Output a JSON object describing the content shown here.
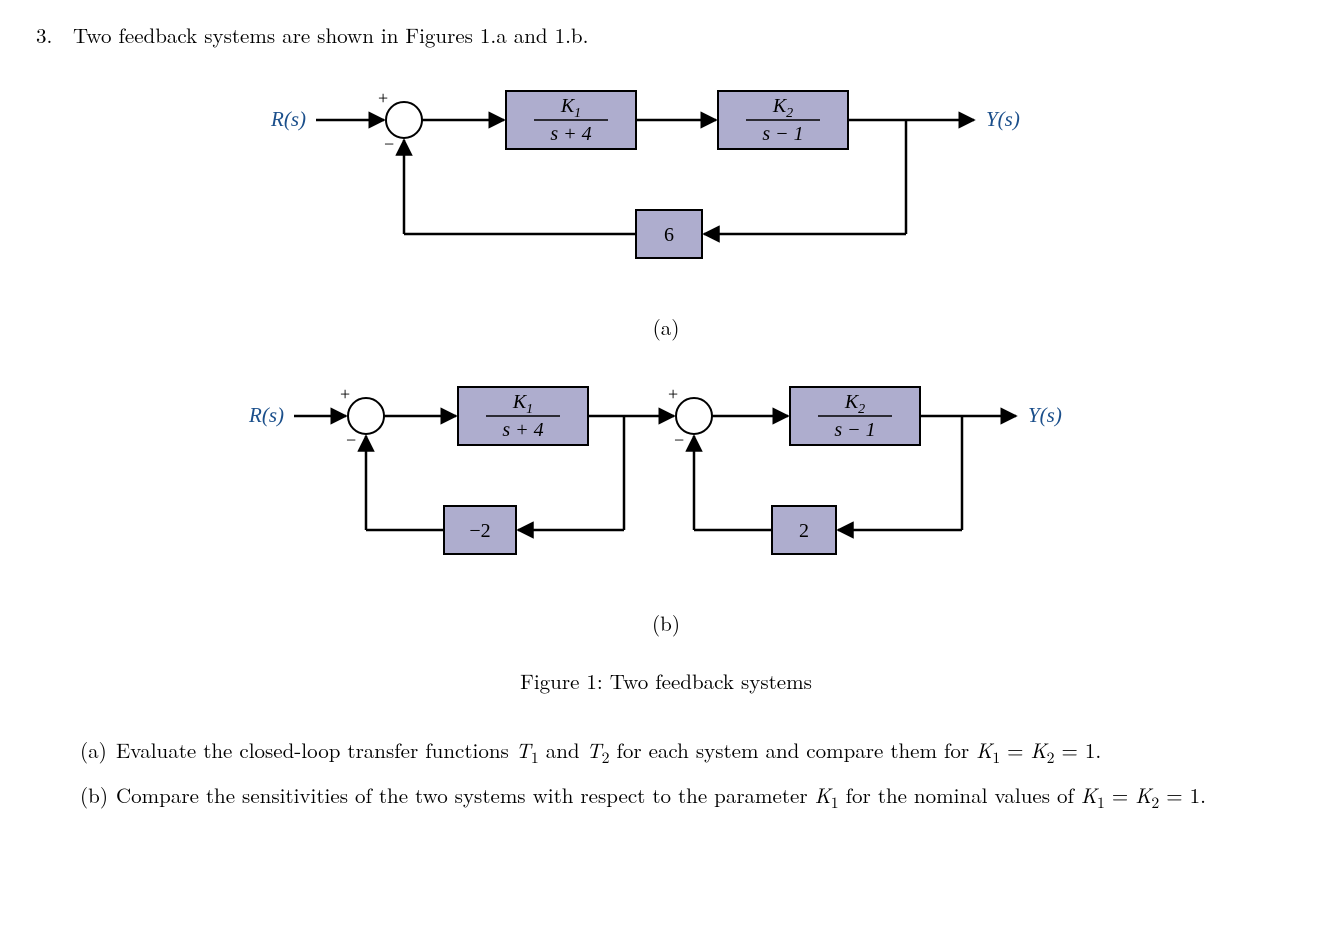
{
  "problem": {
    "number": "3.",
    "text": "Two feedback systems are shown in Figures 1.a and 1.b."
  },
  "figA": {
    "input": "R(s)",
    "output": "Y(s)",
    "b1_num": "K",
    "b1_numsub": "1",
    "b1_den": "s + 4",
    "b2_num": "K",
    "b2_numsub": "2",
    "b2_den": "s − 1",
    "fb": "6",
    "plus": "+",
    "minus": "−",
    "label": "(a)"
  },
  "figB": {
    "input": "R(s)",
    "output": "Y(s)",
    "b1_num": "K",
    "b1_numsub": "1",
    "b1_den": "s + 4",
    "b2_num": "K",
    "b2_numsub": "2",
    "b2_den": "s − 1",
    "fb1": "−2",
    "fb2": "2",
    "plus": "+",
    "minus": "−",
    "label": "(b)"
  },
  "caption": "Figure 1: Two feedback systems",
  "parts": {
    "a_label": "(a)",
    "a_text_1": "Evaluate the closed-loop transfer functions ",
    "a_T1": "T",
    "a_T1s": "1",
    "a_and": " and ",
    "a_T2": "T",
    "a_T2s": "2",
    "a_text_2": " for each system and compare them for ",
    "a_k1": "K",
    "a_k1s": "1",
    "a_eq": " = ",
    "a_k2": "K",
    "a_k2s": "2",
    "a_val": " = 1.",
    "b_label": "(b)",
    "b_text_1": "Compare the sensitivities of the two systems with respect to the parameter ",
    "b_k1": "K",
    "b_k1s": "1",
    "b_text_2": " for the nominal values of ",
    "b_nk1": "K",
    "b_nk1s": "1",
    "b_eq": " = ",
    "b_nk2": "K",
    "b_nk2s": "2",
    "b_val": " = 1."
  }
}
